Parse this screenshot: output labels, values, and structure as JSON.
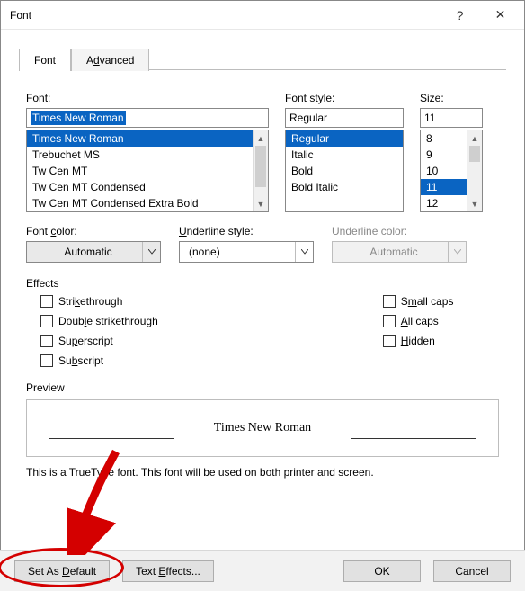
{
  "window": {
    "title": "Font",
    "help": "?",
    "close": "✕"
  },
  "tabs": {
    "active": "Font",
    "inactive": "Advanced",
    "inactive_u": "d"
  },
  "labels": {
    "font": "Font:",
    "font_u": "F",
    "style": "Font style:",
    "style_u": "y",
    "size": "Size:",
    "size_u": "S",
    "fontcolor": "Font color:",
    "fontcolor_u": "c",
    "underline": "Underline style:",
    "underline_u": "U",
    "ulcolor": "Underline color:"
  },
  "font_input": "Times New Roman",
  "font_list": [
    "Times New Roman",
    "Trebuchet MS",
    "Tw Cen MT",
    "Tw Cen MT Condensed",
    "Tw Cen MT Condensed Extra Bold"
  ],
  "style_input": "Regular",
  "style_list": [
    "Regular",
    "Italic",
    "Bold",
    "Bold Italic"
  ],
  "size_input": "11",
  "size_list": [
    "8",
    "9",
    "10",
    "11",
    "12"
  ],
  "font_color": "Automatic",
  "underline_style": "(none)",
  "underline_color": "Automatic",
  "effects_title": "Effects",
  "effects": {
    "strike": "Strikethrough",
    "strike_u": "k",
    "dstrike": "Double strikethrough",
    "dstrike_u": "l",
    "super": "Superscript",
    "super_u": "p",
    "sub": "Subscript",
    "sub_u": "b",
    "smallcaps": "Small caps",
    "smallcaps_u": "m",
    "allcaps": "All caps",
    "allcaps_u": "A",
    "hidden": "Hidden",
    "hidden_u": "H"
  },
  "preview_title": "Preview",
  "preview_text": "Times New Roman",
  "note": "This is a TrueType font. This font will be used on both printer and screen.",
  "buttons": {
    "setdefault": "Set As Default",
    "setdefault_u": "D",
    "texteffects": "Text Effects...",
    "texteffects_u": "E",
    "ok": "OK",
    "cancel": "Cancel"
  }
}
